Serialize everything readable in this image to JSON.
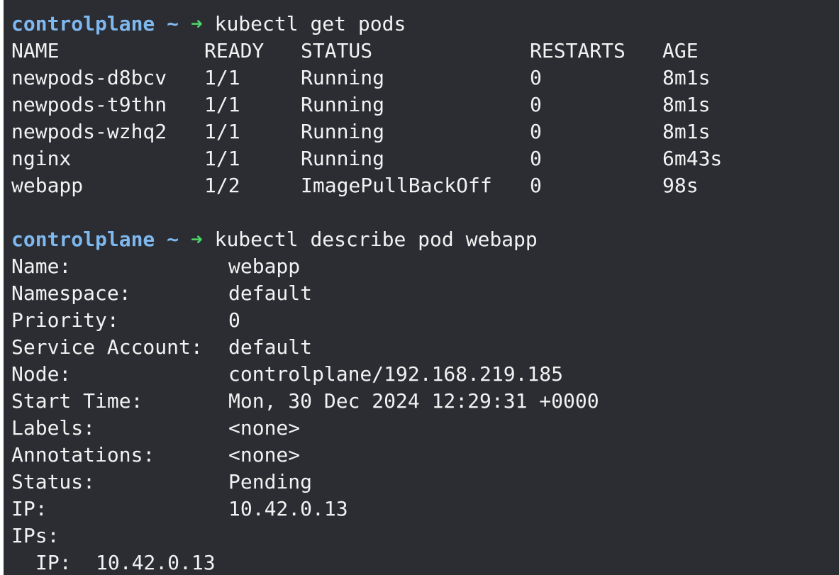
{
  "prompt": {
    "host": "controlplane",
    "cwd": "~",
    "arrow": "➜"
  },
  "commands": {
    "get_pods": "kubectl get pods",
    "describe": "kubectl describe pod webapp"
  },
  "pods_table": {
    "headers": [
      "NAME",
      "READY",
      "STATUS",
      "RESTARTS",
      "AGE"
    ],
    "rows": [
      [
        "newpods-d8bcv",
        "1/1",
        "Running",
        "0",
        "8m1s"
      ],
      [
        "newpods-t9thn",
        "1/1",
        "Running",
        "0",
        "8m1s"
      ],
      [
        "newpods-wzhq2",
        "1/1",
        "Running",
        "0",
        "8m1s"
      ],
      [
        "nginx",
        "1/1",
        "Running",
        "0",
        "6m43s"
      ],
      [
        "webapp",
        "1/2",
        "ImagePullBackOff",
        "0",
        "98s"
      ]
    ]
  },
  "describe": {
    "fields": [
      {
        "key": "Name:",
        "value": "webapp"
      },
      {
        "key": "Namespace:",
        "value": "default"
      },
      {
        "key": "Priority:",
        "value": "0"
      },
      {
        "key": "Service Account:",
        "value": "default"
      },
      {
        "key": "Node:",
        "value": "controlplane/192.168.219.185"
      },
      {
        "key": "Start Time:",
        "value": "Mon, 30 Dec 2024 12:29:31 +0000"
      },
      {
        "key": "Labels:",
        "value": "<none>"
      },
      {
        "key": "Annotations:",
        "value": "<none>"
      },
      {
        "key": "Status:",
        "value": "Pending"
      },
      {
        "key": "IP:",
        "value": "10.42.0.13"
      },
      {
        "key": "IPs:",
        "value": ""
      }
    ],
    "ips_sub": {
      "key": "IP:",
      "value": "10.42.0.13"
    }
  },
  "colors": {
    "background": "#2b2d33",
    "text": "#f2f2f2",
    "prompt_host": "#7fb8ee",
    "prompt_arrow": "#4cd868"
  }
}
